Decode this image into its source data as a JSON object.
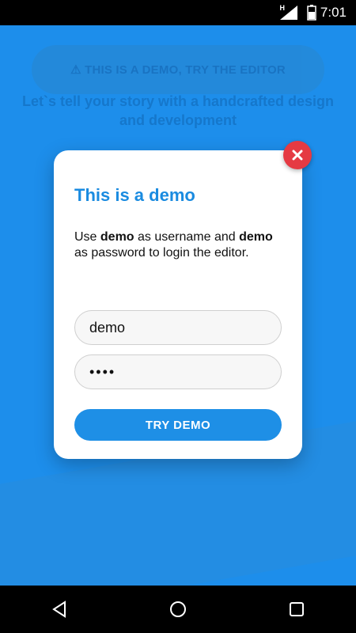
{
  "status_bar": {
    "time": "7:01",
    "network": "H",
    "icons": [
      "signal-icon",
      "battery-icon"
    ]
  },
  "background": {
    "banner_label": "⚠ THIS IS A DEMO, TRY THE EDITOR",
    "tagline": "Let`s tell your story with a handcrafted design and development"
  },
  "modal": {
    "title": "This is a demo",
    "description_parts": [
      {
        "text": "Use ",
        "bold": false
      },
      {
        "text": "demo",
        "bold": true
      },
      {
        "text": " as username and ",
        "bold": false
      },
      {
        "text": "demo",
        "bold": true
      },
      {
        "text": " as password to login the editor.",
        "bold": false
      }
    ],
    "username_value": "demo",
    "password_value": "demo",
    "cta_label": "TRY DEMO",
    "close_icon": "close-icon"
  },
  "nav_bar": {
    "buttons": [
      "back-icon",
      "home-icon",
      "recents-icon"
    ]
  },
  "colors": {
    "primary": "#2196f3",
    "title": "#1a8be0",
    "cta": "#1e8fe6",
    "close": "#e53a43"
  }
}
